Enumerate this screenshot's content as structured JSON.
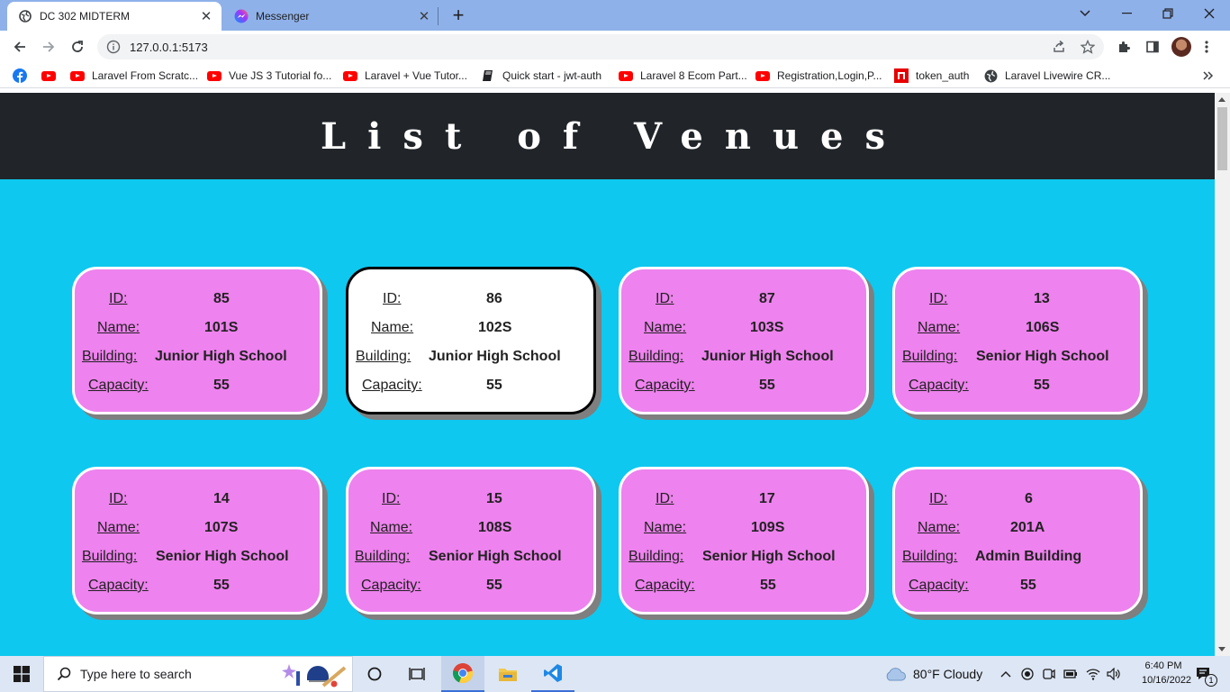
{
  "browser": {
    "tabs": [
      {
        "title": "DC 302 MIDTERM",
        "active": true
      },
      {
        "title": "Messenger",
        "active": false
      }
    ],
    "url": "127.0.0.1:5173",
    "bookmarks": [
      {
        "label": "Laravel From Scratc...",
        "icon": "youtube-icon"
      },
      {
        "label": "Vue JS 3 Tutorial fo...",
        "icon": "youtube-icon"
      },
      {
        "label": "Laravel + Vue Tutor...",
        "icon": "youtube-icon"
      },
      {
        "label": "Quick start - jwt-auth",
        "icon": "book-icon"
      },
      {
        "label": "Laravel 8 Ecom Part...",
        "icon": "youtube-icon"
      },
      {
        "label": "Registration,Login,P...",
        "icon": "youtube-icon"
      },
      {
        "label": "token_auth",
        "icon": "red-square-icon"
      },
      {
        "label": "Laravel Livewire CR...",
        "icon": "globe-icon"
      }
    ]
  },
  "page": {
    "title": "List of Venues",
    "labels": {
      "id": "ID:",
      "name": "Name:",
      "building": "Building:",
      "capacity": "Capacity:"
    },
    "venues": [
      {
        "id": "85",
        "name": "101S",
        "building": "Junior High School",
        "capacity": "55"
      },
      {
        "id": "86",
        "name": "102S",
        "building": "Junior High School",
        "capacity": "55"
      },
      {
        "id": "87",
        "name": "103S",
        "building": "Junior High School",
        "capacity": "55"
      },
      {
        "id": "13",
        "name": "106S",
        "building": "Senior High School",
        "capacity": "55"
      },
      {
        "id": "14",
        "name": "107S",
        "building": "Senior High School",
        "capacity": "55"
      },
      {
        "id": "15",
        "name": "108S",
        "building": "Senior High School",
        "capacity": "55"
      },
      {
        "id": "17",
        "name": "109S",
        "building": "Senior High School",
        "capacity": "55"
      },
      {
        "id": "6",
        "name": "201A",
        "building": "Admin Building",
        "capacity": "55"
      }
    ]
  },
  "taskbar": {
    "search_placeholder": "Type here to search",
    "weather": "80°F  Cloudy",
    "time": "6:40 PM",
    "date": "10/16/2022",
    "notification_count": "1"
  },
  "colors": {
    "card_bg": "#ee82ee",
    "page_bg": "#0ec8ef",
    "header_bg": "#212529"
  }
}
